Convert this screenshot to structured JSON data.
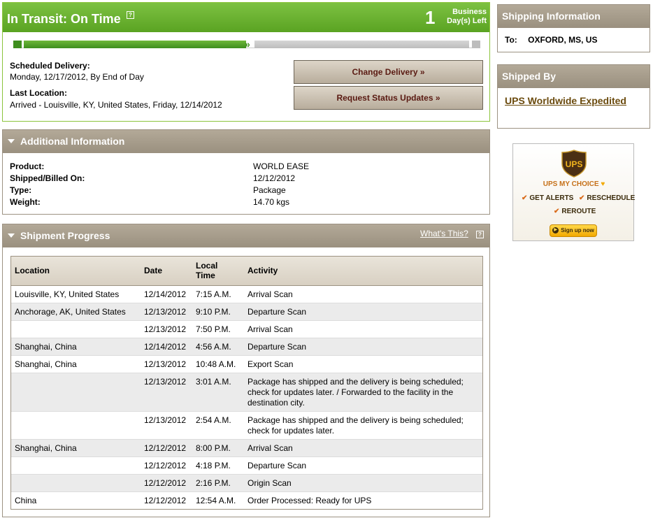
{
  "status": {
    "title": "In Transit: On Time",
    "help": "?",
    "days_number": "1",
    "days_label_line1": "Business",
    "days_label_line2": "Day(s) Left",
    "progress_fraction": 0.5,
    "scheduled_label": "Scheduled Delivery:",
    "scheduled_value": "Monday, 12/17/2012, By End of Day",
    "last_location_label": "Last Location:",
    "last_location_value": "Arrived - Louisville, KY, United States, Friday, 12/14/2012",
    "change_delivery_label": "Change Delivery »",
    "request_updates_label": "Request Status Updates »"
  },
  "additional": {
    "title": "Additional Information",
    "rows": [
      {
        "label": "Product:",
        "value": "WORLD EASE"
      },
      {
        "label": "Shipped/Billed On:",
        "value": "12/12/2012"
      },
      {
        "label": "Type:",
        "value": "Package"
      },
      {
        "label": "Weight:",
        "value": "14.70 kgs"
      }
    ]
  },
  "progress": {
    "title": "Shipment Progress",
    "whats_this": "What's This?",
    "help": "?",
    "headers": {
      "location": "Location",
      "date": "Date",
      "time_line1": "Local",
      "time_line2": "Time",
      "activity": "Activity"
    },
    "rows": [
      {
        "location": "Louisville, KY, United States",
        "date": "12/14/2012",
        "time": "7:15 A.M.",
        "activity": "Arrival Scan"
      },
      {
        "location": "Anchorage, AK, United States",
        "date": "12/13/2012",
        "time": "9:10 P.M.",
        "activity": "Departure Scan"
      },
      {
        "location": "",
        "date": "12/13/2012",
        "time": "7:50 P.M.",
        "activity": "Arrival Scan"
      },
      {
        "location": "Shanghai, China",
        "date": "12/14/2012",
        "time": "4:56 A.M.",
        "activity": "Departure Scan"
      },
      {
        "location": "Shanghai, China",
        "date": "12/13/2012",
        "time": "10:48 A.M.",
        "activity": "Export Scan"
      },
      {
        "location": "",
        "date": "12/13/2012",
        "time": "3:01 A.M.",
        "activity": "Package has shipped and the delivery is being scheduled; check for updates later. / Forwarded to the facility in the destination city."
      },
      {
        "location": "",
        "date": "12/13/2012",
        "time": "2:54 A.M.",
        "activity": "Package has shipped and the delivery is being scheduled; check for updates later."
      },
      {
        "location": "Shanghai, China",
        "date": "12/12/2012",
        "time": "8:00 P.M.",
        "activity": "Arrival Scan"
      },
      {
        "location": "",
        "date": "12/12/2012",
        "time": "4:18 P.M.",
        "activity": "Departure Scan"
      },
      {
        "location": "",
        "date": "12/12/2012",
        "time": "2:16 P.M.",
        "activity": "Origin Scan"
      },
      {
        "location": "China",
        "date": "12/12/2012",
        "time": "12:54 A.M.",
        "activity": "Order Processed: Ready for UPS"
      }
    ]
  },
  "shipping_info": {
    "title": "Shipping Information",
    "to_label": "To:",
    "to_value": "OXFORD, MS, US"
  },
  "shipped_by": {
    "title": "Shipped By",
    "service": "UPS Worldwide Expedited"
  },
  "ad": {
    "logo_text": "UPS",
    "title": "UPS MY CHOICE",
    "items": [
      "GET ALERTS",
      "RESCHEDULE",
      "REROUTE"
    ],
    "signup": "Sign up now",
    "icons": [
      "ups-shield-icon",
      "heart-icon",
      "checkmark-icon",
      "play-icon"
    ]
  },
  "colors": {
    "status_green": "#5aa322",
    "panel_header": "#9a907f",
    "link_brown": "#6b4b0e",
    "button_text": "#5a1a12"
  }
}
